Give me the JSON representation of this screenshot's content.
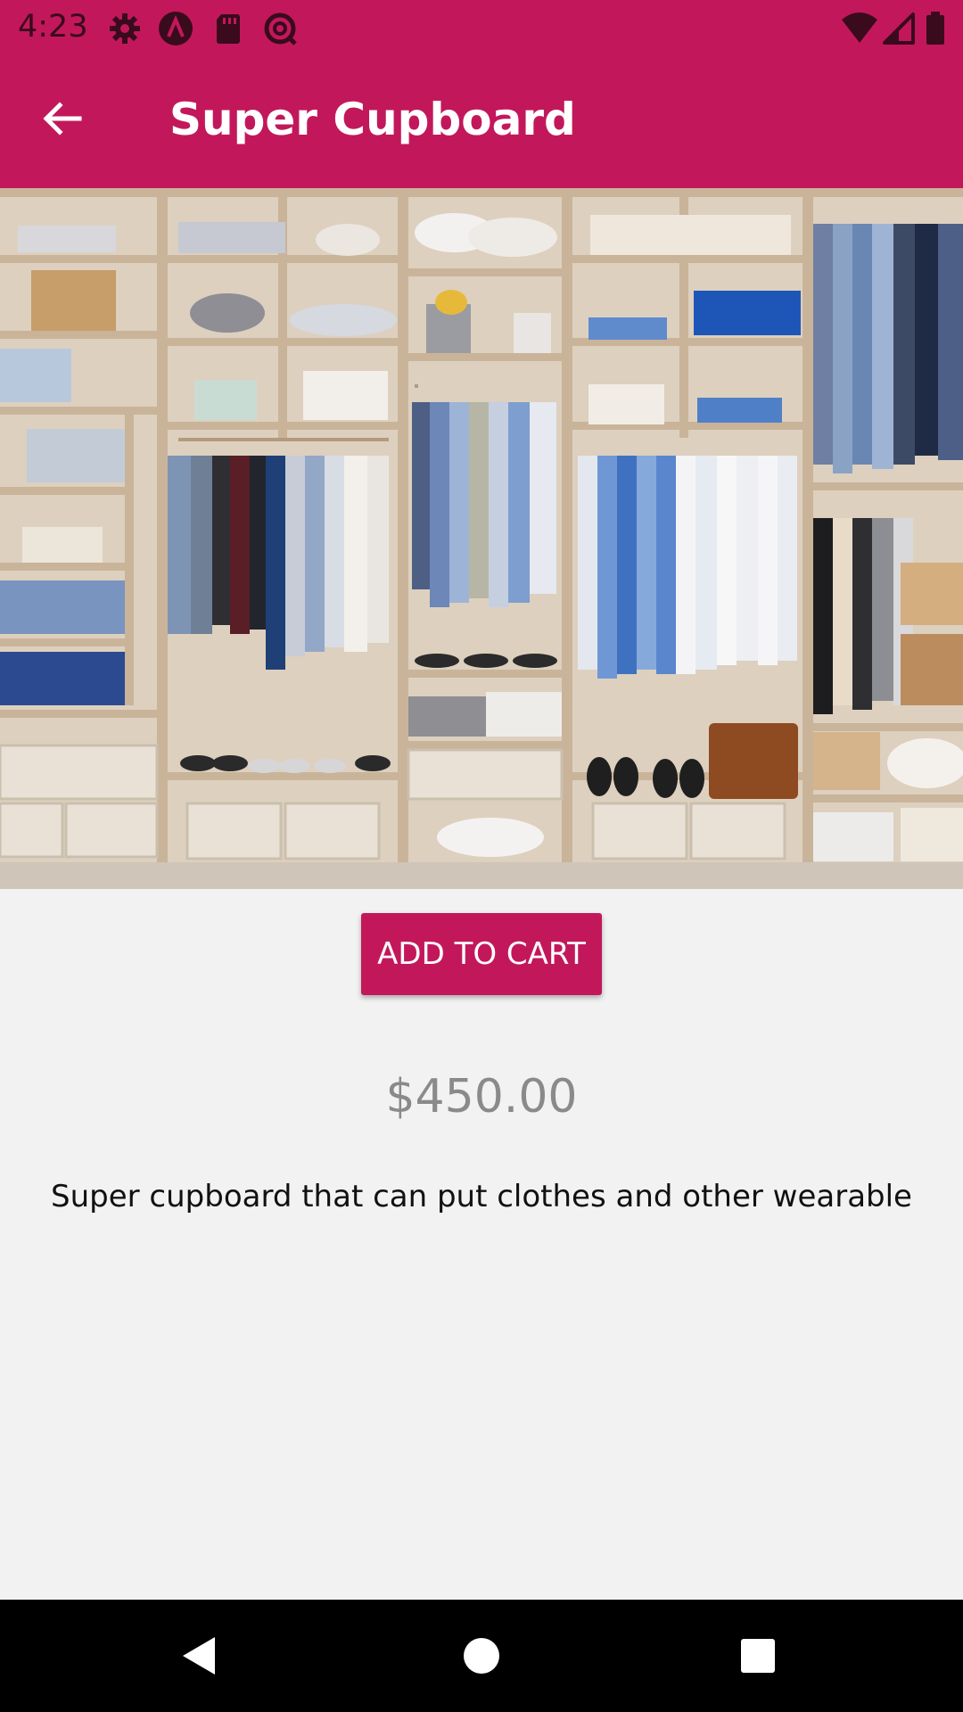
{
  "status_bar": {
    "time": "4:23",
    "left_icons": [
      "settings-icon",
      "a-badge-icon",
      "sd-card-icon",
      "sync-icon"
    ],
    "right_icons": [
      "wifi-icon",
      "cell-signal-icon",
      "battery-icon"
    ]
  },
  "app_bar": {
    "title": "Super Cupboard",
    "back_icon": "arrow-left-icon"
  },
  "product": {
    "image_subject": "cupboard-with-clothes",
    "add_to_cart_label": "ADD TO CART",
    "price": "$450.00",
    "description": "Super cupboard that can put clothes and other wearable"
  },
  "nav_bar": {
    "icons": [
      "back-triangle-icon",
      "home-circle-icon",
      "recents-square-icon"
    ]
  },
  "colors": {
    "primary": "#c2185b",
    "background": "#f2f2f2",
    "price_text": "#8a8a8a",
    "nav_bar": "#000000"
  }
}
